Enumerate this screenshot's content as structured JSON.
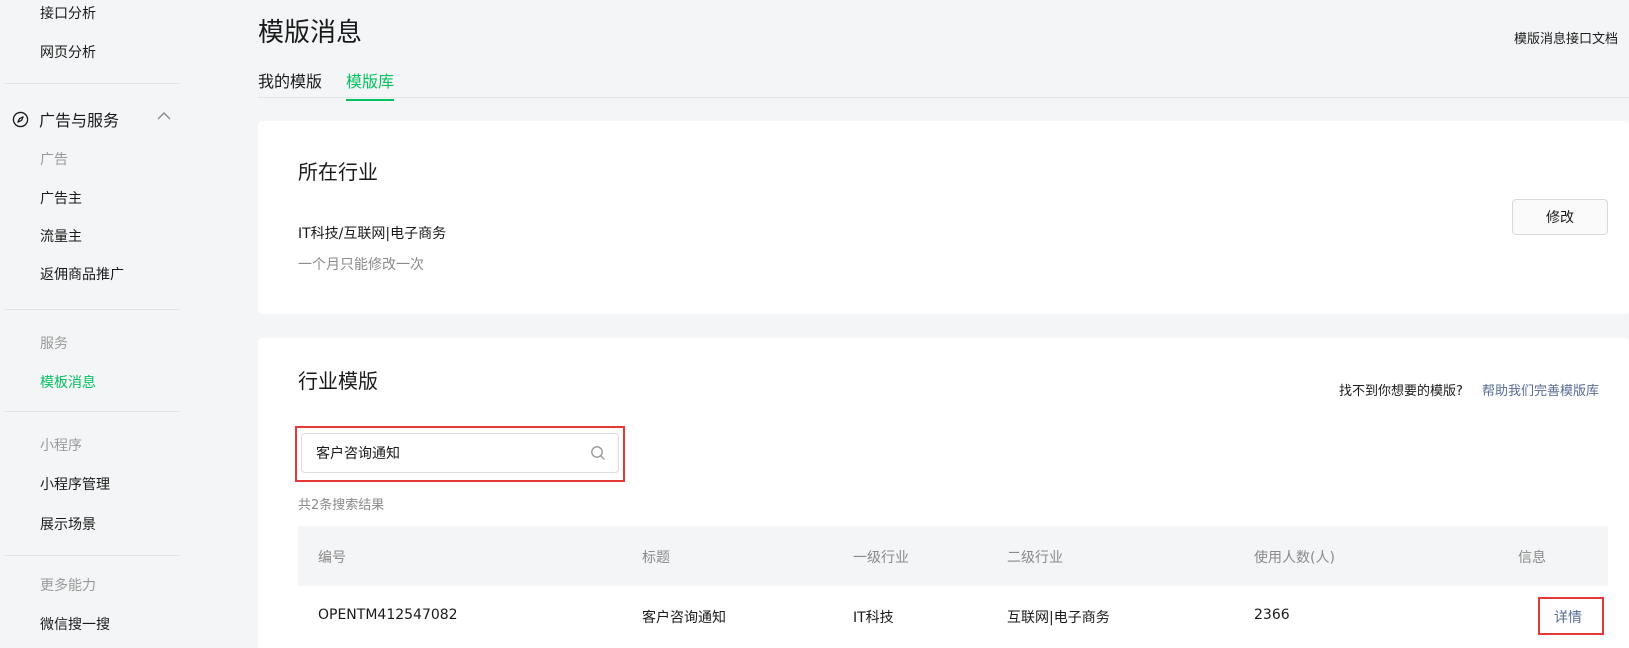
{
  "sidebar": {
    "items_top": [
      "接口分析",
      "网页分析"
    ],
    "group": {
      "label": "广告与服务",
      "icon": "compass-icon"
    },
    "section_ads": {
      "header": "广告",
      "items": [
        "广告主",
        "流量主",
        "返佣商品推广"
      ]
    },
    "section_service": {
      "header": "服务",
      "items": [
        "模板消息"
      ]
    },
    "section_miniprogram": {
      "header": "小程序",
      "items": [
        "小程序管理",
        "展示场景"
      ]
    },
    "section_more": {
      "header": "更多能力",
      "items": [
        "微信搜一搜"
      ]
    }
  },
  "header": {
    "title": "模版消息",
    "doc_link": "模版消息接口文档",
    "tabs": [
      {
        "label": "我的模版",
        "active": false
      },
      {
        "label": "模版库",
        "active": true
      }
    ]
  },
  "industry_card": {
    "title": "所在行业",
    "value": "IT科技/互联网|电子商务",
    "note": "一个月只能修改一次",
    "modify_button": "修改"
  },
  "template_card": {
    "title": "行业模版",
    "help_question": "找不到你想要的模版?",
    "help_link": "帮助我们完善模版库",
    "search_value": "客户咨询通知",
    "result_count": "共2条搜索结果",
    "columns": [
      "编号",
      "标题",
      "一级行业",
      "二级行业",
      "使用人数(人)",
      "信息"
    ],
    "rows": [
      {
        "id": "OPENTM412547082",
        "title": "客户咨询通知",
        "industry1": "IT科技",
        "industry2": "互联网|电子商务",
        "users": "2366",
        "info": "详情"
      }
    ]
  },
  "colors": {
    "accent": "#07c160",
    "link": "#576b95",
    "highlight": "#e53935"
  }
}
